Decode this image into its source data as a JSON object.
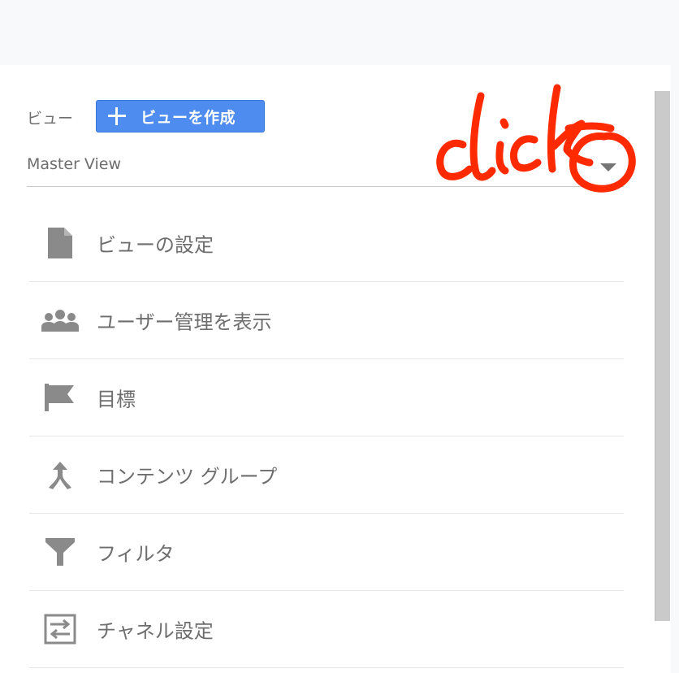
{
  "view_section": {
    "label": "ビュー",
    "create_button_label": "ビューを作成",
    "selected_view": "Master View"
  },
  "annotation": {
    "text": "click",
    "color": "#ff2a00"
  },
  "menu": {
    "items": [
      {
        "label": "ビューの設定",
        "icon": "document-icon"
      },
      {
        "label": "ユーザー管理を表示",
        "icon": "people-icon"
      },
      {
        "label": "目標",
        "icon": "flag-icon"
      },
      {
        "label": "コンテンツ グループ",
        "icon": "merge-icon"
      },
      {
        "label": "フィルタ",
        "icon": "filter-icon"
      },
      {
        "label": "チャネル設定",
        "icon": "channel-settings-icon"
      }
    ]
  },
  "colors": {
    "accent": "#4e8cf0",
    "icon_gray": "#8a8a8a",
    "text_gray": "#6e6e6e"
  }
}
